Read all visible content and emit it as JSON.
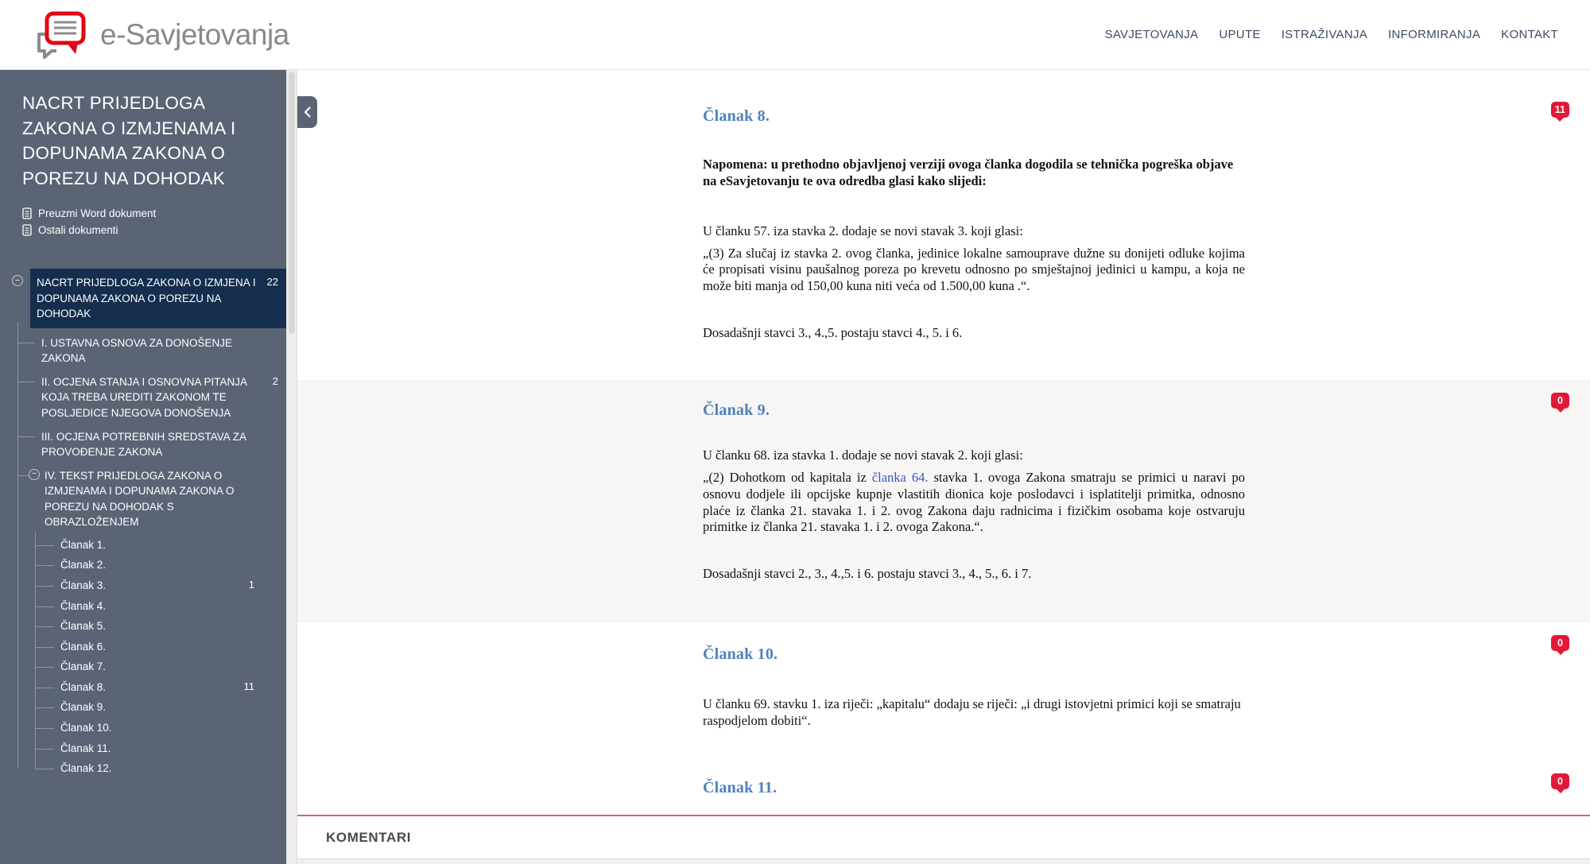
{
  "header": {
    "logo_text": "e-Savjetovanja",
    "nav": [
      {
        "label": "SAVJETOVANJA"
      },
      {
        "label": "UPUTE"
      },
      {
        "label": "ISTRAŽIVANJA"
      },
      {
        "label": "INFORMIRANJA"
      },
      {
        "label": "KONTAKT"
      }
    ]
  },
  "sidebar": {
    "title": "NACRT PRIJEDLOGA ZAKONA O IZMJENAMA I DOPUNAMA ZAKONA O POREZU NA DOHODAK",
    "links": [
      {
        "label": "Preuzmi Word dokument"
      },
      {
        "label": "Ostali dokumenti"
      }
    ],
    "tree": {
      "root": {
        "label": "NACRT PRIJEDLOGA ZAKONA O IZMJENA I DOPUNAMA ZAKONA O POREZU NA DOHODAK",
        "count": "22",
        "toggle": "−"
      },
      "sections": [
        {
          "label": "I. USTAVNA OSNOVA ZA DONOŠENJE ZAKONA",
          "count": ""
        },
        {
          "label": "II. OCJENA STANJA I OSNOVNA PITANJA KOJA TREBA UREDITI ZAKONOM TE POSLJEDICE NJEGOVA DONOŠENJA",
          "count": "2"
        },
        {
          "label": "III. OCJENA POTREBNIH SREDSTAVA ZA PROVOĐENJE  ZAKONA",
          "count": ""
        },
        {
          "label": "IV. TEKST PRIJEDLOGA ZAKONA O IZMJENAMA I DOPUNAMA ZAKONA O POREZU NA DOHODAK S OBRAZLOŽENJEM",
          "count": "",
          "toggle": "−"
        }
      ],
      "articles": [
        {
          "label": "Članak 1.",
          "count": ""
        },
        {
          "label": "Članak 2.",
          "count": ""
        },
        {
          "label": "Članak 3.",
          "count": "1"
        },
        {
          "label": "Članak 4.",
          "count": ""
        },
        {
          "label": "Članak 5.",
          "count": ""
        },
        {
          "label": "Članak 6.",
          "count": ""
        },
        {
          "label": "Članak 7.",
          "count": ""
        },
        {
          "label": "Članak 8.",
          "count": "11"
        },
        {
          "label": "Članak 9.",
          "count": ""
        },
        {
          "label": "Članak 10.",
          "count": ""
        },
        {
          "label": "Članak 11.",
          "count": ""
        },
        {
          "label": "Članak 12.",
          "count": ""
        }
      ]
    }
  },
  "main": {
    "collapse_icon": "❮",
    "sections": [
      {
        "heading": "Članak 8.",
        "note": "Napomena: u prethodno objavljenoj verziji ovoga članka dogodila se tehnička pogreška objave na eSavjetovanju te ova odredba glasi kako slijedi:",
        "p1": "U članku 57. iza stavka 2. dodaje se novi stavak 3. koji glasi:",
        "p2": "„(3) Za slučaj iz stavka 2. ovog članka, jedinice lokalne samouprave dužne su donijeti odluke kojima će propisati visinu paušalnog poreza po krevetu odnosno po smještajnoj jedinici u kampu, a koja ne može biti manja od 150,00 kuna niti veća od 1.500,00 kuna .“.",
        "p3": "Dosadašnji stavci 3., 4.,5. postaju stavci 4., 5. i 6.",
        "badge": "11"
      },
      {
        "heading": "Članak 9.",
        "p1": "U članku 68. iza stavka 1. dodaje se novi stavak 2. koji glasi:",
        "p2_before": "„(2) Dohotkom od kapitala iz ",
        "p2_link": "članka 64.",
        "p2_after": " stavka 1. ovoga Zakona smatraju se primici u naravi po osnovu dodjele ili opcijske kupnje vlastitih dionica koje poslodavci i isplatitelji primitka, odnosno plaće iz članka 21. stavaka 1. i 2. ovog Zakona daju radnicima i fizičkim osobama koje ostvaruju primitke iz članka 21. stavaka 1. i 2. ovoga Zakona.“.",
        "p3": "Dosadašnji stavci 2., 3., 4.,5. i 6. postaju stavci 3., 4., 5., 6. i 7.",
        "badge": "0"
      },
      {
        "heading": "Članak 10.",
        "p1": "U članku 69. stavku 1. iza riječi: „kapitalu“ dodaju se riječi: „i drugi istovjetni primici koji se smatraju raspodjelom dobiti“.",
        "badge": "0"
      },
      {
        "heading": "Članak 11.",
        "badge": "0"
      }
    ],
    "comments_label": "KOMENTARI"
  },
  "colors": {
    "logo_red": "#e30613",
    "logo_gray": "#87898c",
    "sidebar_bg": "#5b6474",
    "sidebar_selected": "#152e4d",
    "nav_text": "#3c4b63",
    "heading_blue": "#4f81bd",
    "link_blue": "#3b55c4",
    "badge_red": "#e31837",
    "section_gray": "#f7f6f4",
    "divider_red": "#e4605c"
  }
}
